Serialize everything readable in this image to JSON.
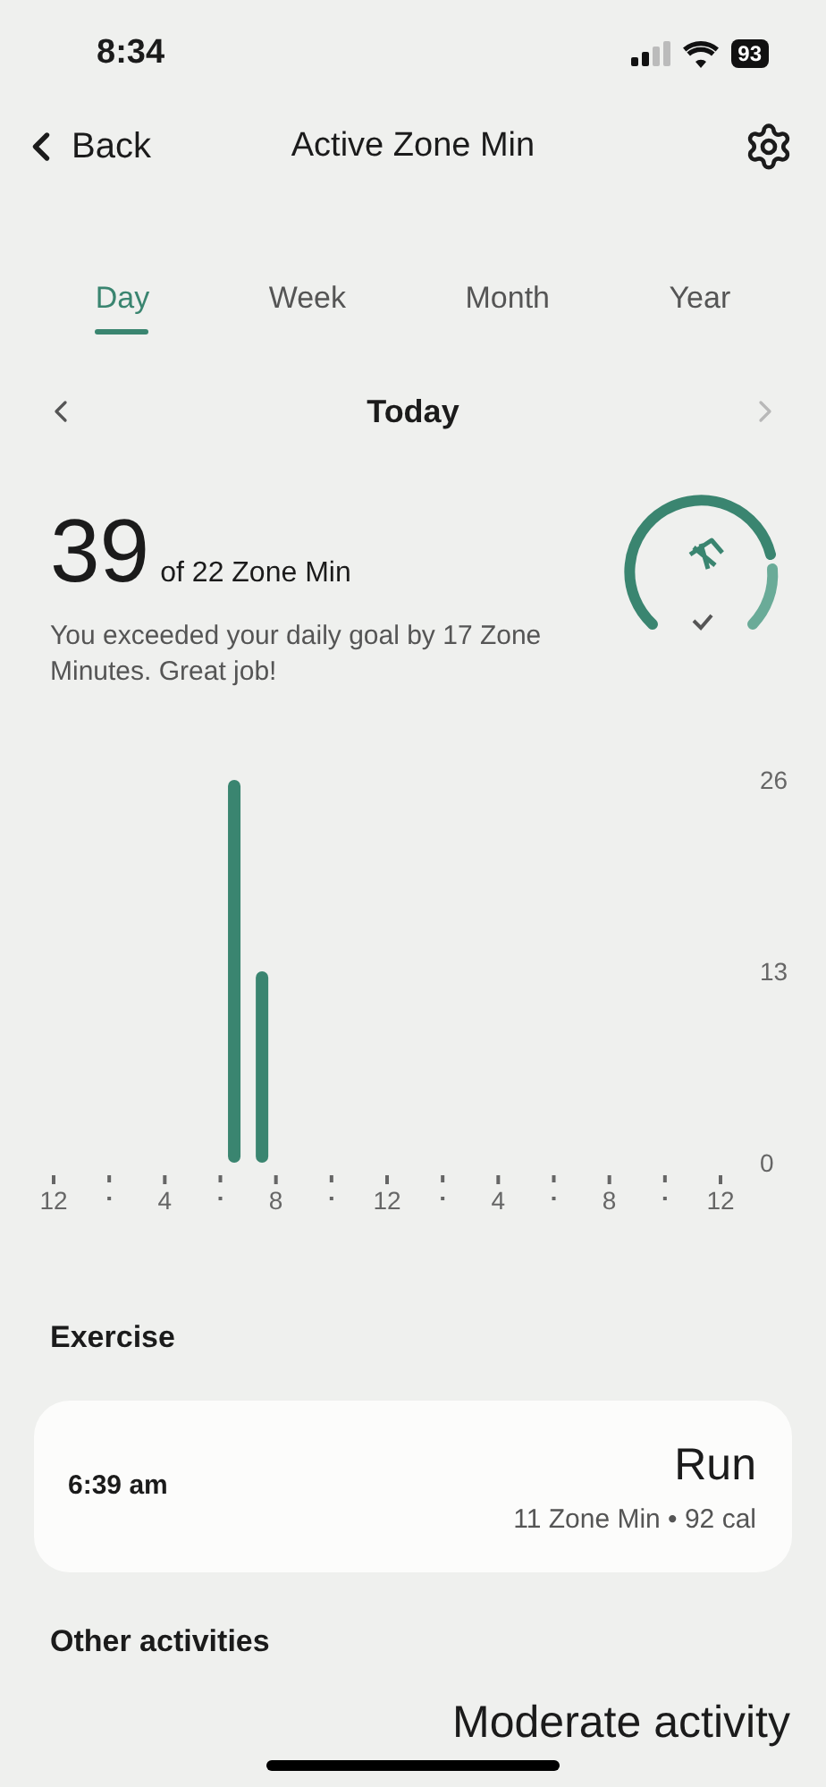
{
  "status_bar": {
    "time": "8:34",
    "battery": "93"
  },
  "header": {
    "back": "Back",
    "title": "Active Zone Min"
  },
  "tabs": [
    {
      "label": "Day",
      "selected": true
    },
    {
      "label": "Week",
      "selected": false
    },
    {
      "label": "Month",
      "selected": false
    },
    {
      "label": "Year",
      "selected": false
    }
  ],
  "date_nav": {
    "label": "Today",
    "next_disabled": true
  },
  "summary": {
    "value": "39",
    "goal": "of 22 Zone Min",
    "message": "You exceeded your daily goal by 17 Zone Minutes. Great job!",
    "goal_met": true
  },
  "chart_data": {
    "type": "bar",
    "categories": [
      "12",
      null,
      null,
      null,
      null,
      null,
      null,
      null,
      "4",
      null,
      null,
      null,
      null,
      null,
      null,
      null,
      "8",
      null,
      null,
      null,
      null,
      null,
      null,
      null,
      "12",
      null,
      null,
      null,
      null,
      null,
      null,
      null,
      "4",
      null,
      null,
      null,
      null,
      null,
      null,
      null,
      "8",
      null,
      null,
      null,
      null,
      null,
      null,
      null,
      "12"
    ],
    "series": [
      {
        "color": "#3a8570",
        "values": [
          null,
          null,
          null,
          null,
          null,
          null,
          null,
          null,
          null,
          null,
          null,
          null,
          null,
          26,
          null,
          13,
          null,
          null,
          null,
          null,
          null,
          null,
          null,
          null,
          null,
          null,
          null,
          null,
          null,
          null,
          null,
          null,
          null,
          null,
          null,
          null,
          null,
          null,
          null,
          null,
          null,
          null,
          null,
          null,
          null,
          null,
          null,
          null,
          null
        ]
      }
    ],
    "ylim": [
      0,
      26
    ],
    "yticks": [
      0,
      13,
      26
    ]
  },
  "exercise": {
    "heading": "Exercise",
    "items": [
      {
        "time": "6:39 am",
        "name": "Run",
        "detail": "11 Zone Min • 92 cal"
      }
    ]
  },
  "other": {
    "heading": "Other activities",
    "items": [
      "Moderate activity"
    ]
  }
}
